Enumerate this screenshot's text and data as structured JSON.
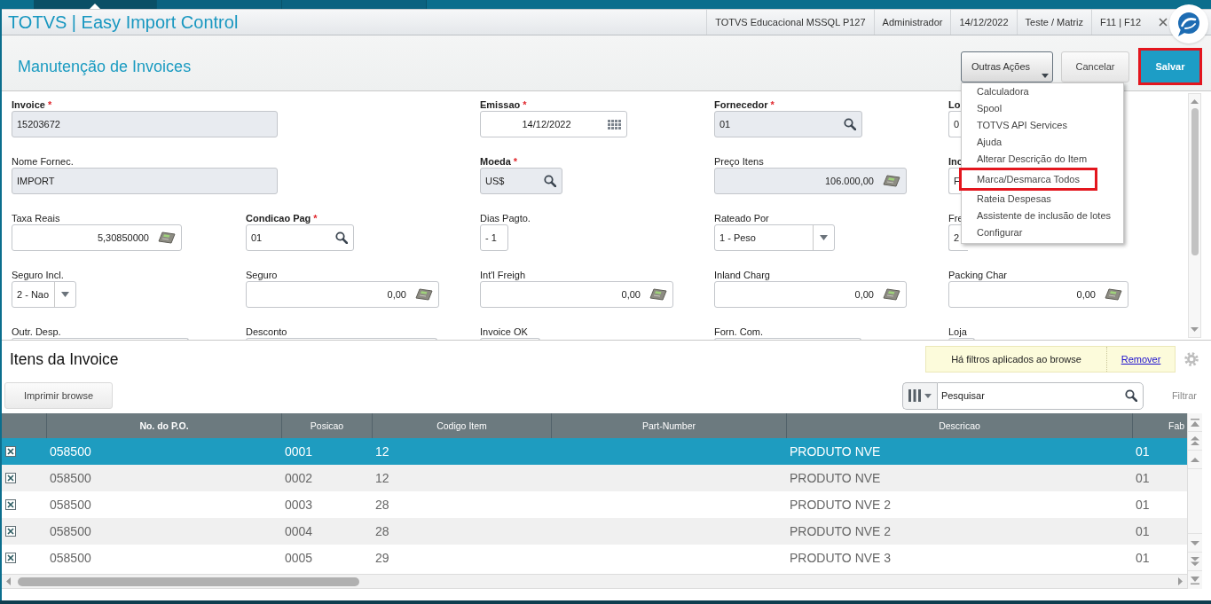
{
  "top_tabs": [
    {
      "selected": true
    },
    {
      "selected": false
    },
    {
      "selected": false
    }
  ],
  "window": {
    "title": "TOTVS | Easy Import Control",
    "info": [
      "TOTVS Educacional MSSQL P127",
      "Administrador",
      "14/12/2022",
      "Teste / Matriz",
      "F11 | F12"
    ]
  },
  "page": {
    "title": "Manutenção de Invoices",
    "actions": [
      {
        "label": "Outras Ações",
        "kind": "menu",
        "highlighted": false
      },
      {
        "label": "Cancelar",
        "kind": "default",
        "highlighted": false
      },
      {
        "label": "Salvar",
        "kind": "primary",
        "highlighted": true
      }
    ]
  },
  "actions_menu": {
    "items": [
      {
        "label": "Calculadora",
        "highlighted": false
      },
      {
        "label": "Spool",
        "highlighted": false
      },
      {
        "label": "TOTVS API Services",
        "highlighted": false
      },
      {
        "label": "Ajuda",
        "highlighted": false
      },
      {
        "label": "Alterar Descrição do Item",
        "highlighted": false
      },
      {
        "label": "Marca/Desmarca Todos",
        "highlighted": true
      },
      {
        "label": "Rateia Despesas",
        "highlighted": false
      },
      {
        "label": "Assistente de inclusão de lotes",
        "highlighted": false
      },
      {
        "label": "Configurar",
        "highlighted": false
      }
    ]
  },
  "form": {
    "rows": [
      [
        {
          "label": "Invoice",
          "mark": "*",
          "bold": true,
          "kind": "text",
          "readonly": true,
          "value": "15203672"
        },
        {
          "label": "Emissao",
          "mark": "*",
          "bold": true,
          "kind": "date",
          "readonly": false,
          "value": "14/12/2022"
        },
        {
          "label": "Fornecedor",
          "mark": "*",
          "bold": true,
          "kind": "lookup",
          "readonly": true,
          "value": "01"
        },
        {
          "label": "Lo",
          "bold": true,
          "kind": "text",
          "readonly": false,
          "value": "0"
        }
      ],
      [
        {
          "label": "Nome Fornec.",
          "bold": false,
          "kind": "text",
          "readonly": true,
          "value": "IMPORT"
        },
        {
          "label": "Moeda",
          "mark": "*",
          "bold": true,
          "kind": "lookup",
          "readonly": true,
          "value": "US$"
        },
        {
          "label": "Preço Itens",
          "bold": false,
          "kind": "calc",
          "readonly": true,
          "value": "106.000,00"
        },
        {
          "label": "Inc",
          "bold": true,
          "kind": "text",
          "readonly": false,
          "value": "F"
        }
      ],
      [
        {
          "label": "Taxa Reais",
          "bold": false,
          "kind": "calc",
          "readonly": false,
          "value": "5,30850000"
        },
        {
          "label": "Condicao Pag",
          "mark": "*",
          "bold": true,
          "kind": "lookup",
          "readonly": false,
          "value": "01"
        },
        {
          "label": "Dias Pagto.",
          "bold": false,
          "kind": "text",
          "readonly": false,
          "value": "- 1"
        },
        {
          "label": "Rateado Por",
          "bold": false,
          "kind": "select",
          "readonly": false,
          "value": "1 - Peso"
        },
        {
          "label": "Fre",
          "bold": false,
          "kind": "text",
          "readonly": false,
          "value": "2"
        }
      ],
      [
        {
          "label": "Seguro Incl.",
          "bold": false,
          "kind": "select",
          "readonly": false,
          "value": "2 - Nao"
        },
        {
          "label": "Seguro",
          "bold": false,
          "kind": "calc",
          "readonly": false,
          "value": "0,00"
        },
        {
          "label": "Int'l Freigh",
          "bold": false,
          "kind": "calc",
          "readonly": false,
          "value": "0,00"
        },
        {
          "label": "Inland Charg",
          "bold": false,
          "kind": "calc",
          "readonly": false,
          "value": "0,00"
        },
        {
          "label": "Packing Char",
          "bold": false,
          "kind": "calc",
          "readonly": false,
          "value": "0,00"
        }
      ],
      [
        {
          "label": "Outr. Desp.",
          "bold": false,
          "kind": "edge",
          "readonly": false
        },
        {
          "label": "Desconto",
          "bold": false,
          "kind": "edge",
          "readonly": false
        },
        {
          "label": "Invoice OK",
          "bold": false,
          "kind": "edge",
          "readonly": false
        },
        {
          "label": "Forn. Com.",
          "bold": false,
          "kind": "edge",
          "readonly": false
        },
        {
          "label": "Loja",
          "bold": false,
          "kind": "edge",
          "readonly": false
        }
      ]
    ]
  },
  "items": {
    "title": "Itens da Invoice",
    "filter_notice": {
      "text": "Há filtros aplicados ao browse",
      "link": "Remover"
    },
    "print_button": "Imprimir browse",
    "search": {
      "placeholder": "Pesquisar"
    },
    "filter_button": "Filtrar",
    "table": {
      "columns": [
        {
          "label": "No. do P.O.",
          "sorted": true
        },
        {
          "label": "Posicao",
          "sorted": false
        },
        {
          "label": "Codigo Item",
          "sorted": false
        },
        {
          "label": "Part-Number",
          "sorted": false
        },
        {
          "label": "Descricao",
          "sorted": false
        },
        {
          "label": "Fab",
          "sorted": false
        }
      ],
      "rows": [
        {
          "selected": true,
          "checked": true,
          "no_do_po": "058500",
          "posicao": "0001",
          "codigo_item": "12",
          "descricao": "PRODUTO NVE",
          "fab": "01"
        },
        {
          "selected": false,
          "checked": true,
          "no_do_po": "058500",
          "posicao": "0002",
          "codigo_item": "12",
          "descricao": "PRODUTO NVE",
          "fab": "01"
        },
        {
          "selected": false,
          "checked": true,
          "no_do_po": "058500",
          "posicao": "0003",
          "codigo_item": "28",
          "descricao": "PRODUTO NVE 2",
          "fab": "01"
        },
        {
          "selected": false,
          "checked": true,
          "no_do_po": "058500",
          "posicao": "0004",
          "codigo_item": "28",
          "descricao": "PRODUTO NVE 2",
          "fab": "01"
        },
        {
          "selected": false,
          "checked": true,
          "no_do_po": "058500",
          "posicao": "0005",
          "codigo_item": "29",
          "descricao": "PRODUTO NVE 3",
          "fab": "01"
        }
      ]
    }
  }
}
